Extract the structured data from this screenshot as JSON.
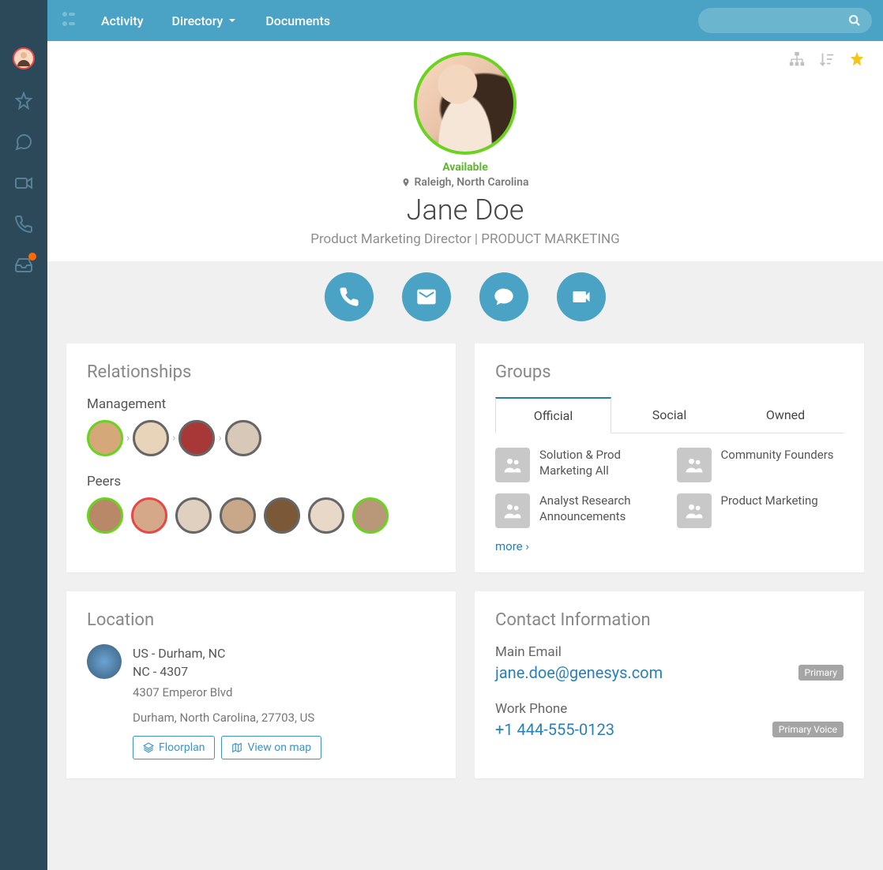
{
  "nav": {
    "activity": "Activity",
    "directory": "Directory",
    "documents": "Documents"
  },
  "profile": {
    "status": "Available",
    "location": "Raleigh, North Carolina",
    "name": "Jane Doe",
    "title": "Product Marketing Director | PRODUCT MARKETING"
  },
  "relationships": {
    "title": "Relationships",
    "management_label": "Management",
    "peers_label": "Peers"
  },
  "groups": {
    "title": "Groups",
    "tabs": {
      "official": "Official",
      "social": "Social",
      "owned": "Owned"
    },
    "items": [
      "Solution & Prod Marketing All",
      "Community Founders",
      "Analyst Research Announcements",
      "Product Marketing"
    ],
    "more": "more ›"
  },
  "location_card": {
    "title": "Location",
    "line1": "US - Durham, NC",
    "line2": "NC - 4307",
    "addr1": "4307 Emperor Blvd",
    "addr2": "Durham, North Carolina, 27703, US",
    "floorplan": "Floorplan",
    "view_map": "View on map"
  },
  "contact": {
    "title": "Contact Information",
    "email_label": "Main Email",
    "email": "jane.doe@genesys.com",
    "email_badge": "Primary",
    "phone_label": "Work Phone",
    "phone": "+1 444-555-0123",
    "phone_badge": "Primary Voice"
  }
}
